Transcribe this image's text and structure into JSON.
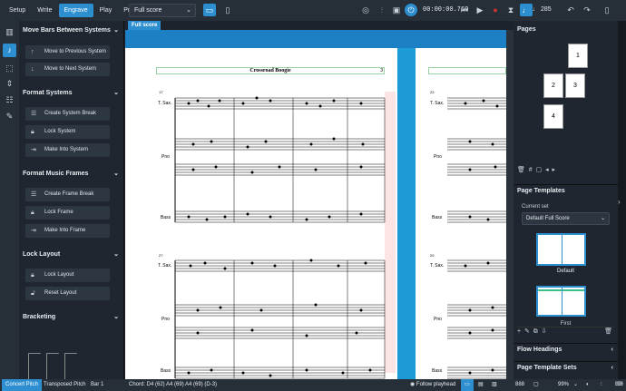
{
  "modes": [
    "Setup",
    "Write",
    "Engrave",
    "Play",
    "Print"
  ],
  "active_mode": "Engrave",
  "layout_select": "Full score",
  "transport_time": "00:00:00.769",
  "tempo": "285",
  "left_panel": {
    "sections": [
      {
        "title": "Move Bars Between Systems",
        "buttons": [
          "Move to Previous System",
          "Move to Next System"
        ]
      },
      {
        "title": "Format Systems",
        "buttons": [
          "Create System Break",
          "Lock System",
          "Make Into System"
        ]
      },
      {
        "title": "Format Music Frames",
        "buttons": [
          "Create Frame Break",
          "Lock Frame",
          "Make Into Frame"
        ]
      },
      {
        "title": "Lock Layout",
        "buttons": [
          "Lock Layout",
          "Reset Layout"
        ]
      },
      {
        "title": "Bracketing",
        "buttons": []
      }
    ]
  },
  "sheet_tab": "Full score",
  "score": {
    "title": "Crossroad Boogie",
    "title_box_num": "3",
    "staves": [
      "T. Sax.",
      "Pno",
      "Bass"
    ],
    "system1_bar": "17",
    "system2_bar": "27",
    "right_bar1": "23",
    "right_bar2": "29"
  },
  "right_panel": {
    "pages_title": "Pages",
    "page_numbers": [
      "1",
      "2",
      "3",
      "4"
    ],
    "page_templates_title": "Page Templates",
    "current_set_label": "Current set",
    "current_set_value": "Default Full Score",
    "template_names": [
      "Default",
      "First"
    ],
    "flow_headings": "Flow Headings",
    "page_template_sets": "Page Template Sets"
  },
  "status": {
    "concert_pitch": "Concert Pitch",
    "transposed_pitch": "Transposed Pitch",
    "bar": "Bar 1",
    "chord": "Chord: D4 (62) A4 (69) A4 (69) (D-3)",
    "follow_playhead": "Follow playhead",
    "zoom": "99%",
    "zoom_num": "888"
  },
  "colors": {
    "accent": "#2e8fd0",
    "panel": "#1f262f"
  }
}
